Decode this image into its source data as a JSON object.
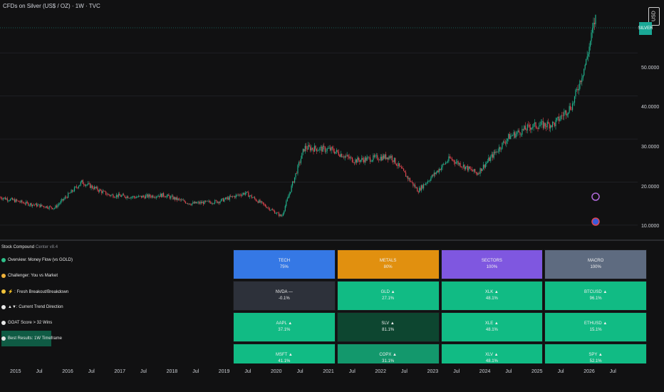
{
  "header": {
    "symbol_title": "CFDs on Silver (US$ / OZ) · 1W · TVC",
    "currency_badge": "USD",
    "price_tag": "SILVER"
  },
  "y_axis": {
    "labels": [
      "50.0000",
      "40.0000",
      "30.0000",
      "20.0000",
      "10.0000"
    ]
  },
  "x_axis": {
    "labels": [
      "2015",
      "Jul",
      "2016",
      "Jul",
      "2017",
      "Jul",
      "2018",
      "Jul",
      "2019",
      "Jul",
      "2020",
      "Jul",
      "2021",
      "Jul",
      "2022",
      "Jul",
      "2023",
      "Jul",
      "2024",
      "Jul",
      "2025",
      "Jul",
      "2026",
      "Jul"
    ]
  },
  "indicator_legend": {
    "title_main": "Stock Compound",
    "title_dim": "Center v8.4",
    "items": [
      {
        "label": "Overview: Money Flow (vs GOLD)",
        "color": "#2fbf8a",
        "active": false
      },
      {
        "label": "Challenger: You vs Market",
        "color": "#f0b23a",
        "active": false
      },
      {
        "label": "⚡ : Fresh Breakout/Breakdown",
        "color": "#f0c23a",
        "active": false
      },
      {
        "label": "▲▼: Current Trend Direction",
        "color": "#e6e6e6",
        "active": false
      },
      {
        "label": "GOAT Score > 32 Wins",
        "color": "#e6e6e6",
        "active": false
      },
      {
        "label": "Best Results: 1W Timeframe",
        "color": "#e6e6e6",
        "active": true
      }
    ]
  },
  "heatmap": {
    "rows": [
      [
        {
          "t": "TECH",
          "v": "75%",
          "bg": "#3578e5"
        },
        {
          "t": "METALS",
          "v": "80%",
          "bg": "#e1900f"
        },
        {
          "t": "SECTORS",
          "v": "100%",
          "bg": "#7f57e0"
        },
        {
          "t": "MACRO",
          "v": "100%",
          "bg": "#5e6b80"
        }
      ],
      [
        {
          "t": "NVDA —",
          "v": "-0.1%",
          "bg": "#2d313a"
        },
        {
          "t": "GLD ▲",
          "v": "27.1%",
          "bg": "#11bb84"
        },
        {
          "t": "XLK ▲",
          "v": "48.1%",
          "bg": "#11bb84"
        },
        {
          "t": "BTCUSD ▲",
          "v": "96.1%",
          "bg": "#11bb84"
        }
      ],
      [
        {
          "t": "AAPL ▲",
          "v": "37.1%",
          "bg": "#11bb84"
        },
        {
          "t": "SLV ▲",
          "v": "81.1%",
          "bg": "#0d4630"
        },
        {
          "t": "XLE ▲",
          "v": "48.1%",
          "bg": "#11bb84"
        },
        {
          "t": "ETHUSD ▲",
          "v": "15.1%",
          "bg": "#11bb84"
        }
      ],
      [
        {
          "t": "MSFT ▲",
          "v": "41.1%",
          "bg": "#11bb84"
        },
        {
          "t": "COPX ▲",
          "v": "31.1%",
          "bg": "#13986c"
        },
        {
          "t": "XLV ▲",
          "v": "48.1%",
          "bg": "#11bb84"
        },
        {
          "t": "SPY ▲",
          "v": "52.1%",
          "bg": "#11bb84"
        }
      ]
    ]
  },
  "chart_data": {
    "type": "candlestick",
    "title": "CFDs on Silver (US$ / OZ) · 1W · TVC",
    "x_range": [
      "2015-01",
      "2026-01"
    ],
    "ylim": [
      8,
      56
    ],
    "y_ticks": [
      10,
      20,
      30,
      40,
      50
    ],
    "series": [
      {
        "values_by_year": [
          {
            "x": "2015-01",
            "y": 16.5
          },
          {
            "x": "2015-07",
            "y": 15.0
          },
          {
            "x": "2016-01",
            "y": 14.0
          },
          {
            "x": "2016-07",
            "y": 20.0
          },
          {
            "x": "2017-01",
            "y": 17.0
          },
          {
            "x": "2017-07",
            "y": 16.5
          },
          {
            "x": "2018-01",
            "y": 17.0
          },
          {
            "x": "2018-07",
            "y": 15.0
          },
          {
            "x": "2019-01",
            "y": 15.5
          },
          {
            "x": "2019-07",
            "y": 17.5
          },
          {
            "x": "2020-03",
            "y": 12.0
          },
          {
            "x": "2020-08",
            "y": 28.0
          },
          {
            "x": "2021-02",
            "y": 27.5
          },
          {
            "x": "2021-07",
            "y": 25.0
          },
          {
            "x": "2022-03",
            "y": 26.0
          },
          {
            "x": "2022-09",
            "y": 18.0
          },
          {
            "x": "2023-04",
            "y": 25.5
          },
          {
            "x": "2023-10",
            "y": 22.0
          },
          {
            "x": "2024-05",
            "y": 30.5
          },
          {
            "x": "2024-10",
            "y": 33.0
          },
          {
            "x": "2025-03",
            "y": 33.5
          },
          {
            "x": "2025-07",
            "y": 38.0
          },
          {
            "x": "2025-10",
            "y": 48.0
          },
          {
            "x": "2025-12",
            "y": 58.0
          }
        ]
      }
    ]
  }
}
